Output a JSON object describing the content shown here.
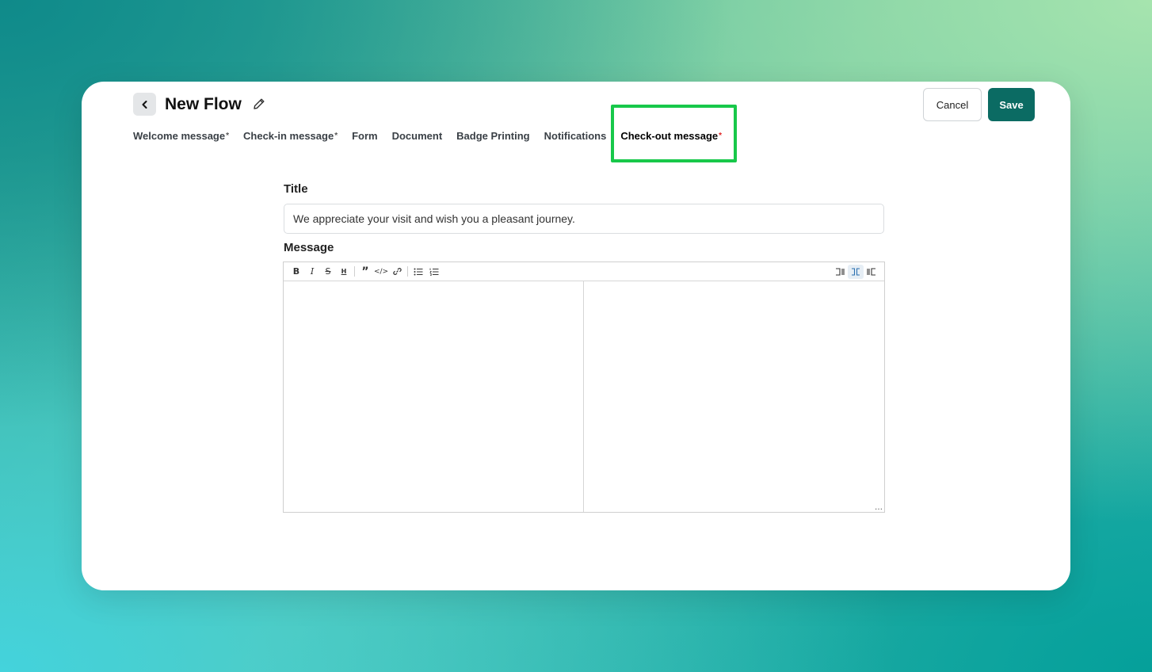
{
  "header": {
    "title": "New Flow",
    "cancel_label": "Cancel",
    "save_label": "Save"
  },
  "tabs": [
    {
      "label": "Welcome message",
      "required": "*"
    },
    {
      "label": "Check-in message",
      "required": "*"
    },
    {
      "label": "Form",
      "required": ""
    },
    {
      "label": "Document",
      "required": ""
    },
    {
      "label": "Badge Printing",
      "required": ""
    },
    {
      "label": "Notifications",
      "required": ""
    },
    {
      "label": "Check-out message",
      "required": "*",
      "active": true
    }
  ],
  "form": {
    "title_label": "Title",
    "title_value": "We appreciate your visit and wish you a pleasant journey.",
    "message_label": "Message"
  },
  "colors": {
    "primary": "#0b6b63",
    "highlight": "#18c84a",
    "required_active": "#e02424"
  }
}
